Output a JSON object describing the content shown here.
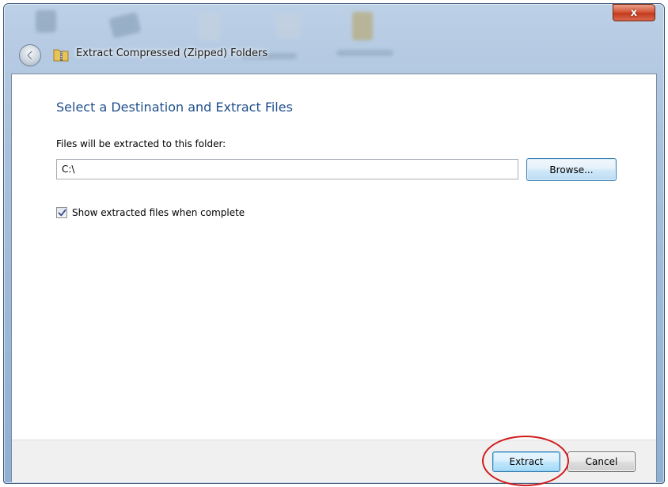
{
  "window": {
    "title": "Extract Compressed (Zipped) Folders",
    "close_label": "x"
  },
  "content": {
    "heading": "Select a Destination and Extract Files",
    "field_label": "Files will be extracted to this folder:",
    "path_value": "C:\\",
    "browse_label": "Browse...",
    "show_files_label": "Show extracted files when complete",
    "show_files_checked": true
  },
  "footer": {
    "extract_label": "Extract",
    "cancel_label": "Cancel"
  },
  "annotation": {
    "highlight_color": "#d11a1a",
    "highlight_target": "extract-button"
  },
  "colors": {
    "heading": "#1f4f8b",
    "frame": "#a9c1dc",
    "close_button": "#c43a1d"
  },
  "icons": {
    "back": "back-arrow-icon",
    "title": "zip-folder-icon",
    "check": "checkmark-icon"
  }
}
